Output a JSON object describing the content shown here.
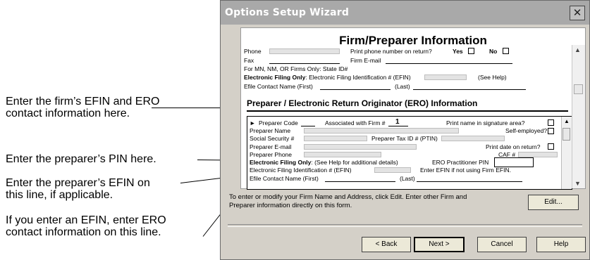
{
  "callouts": [
    {
      "line1": "Enter the firm’s EFIN and ERO",
      "line2": "contact information here."
    },
    {
      "line1": "Enter the preparer’s PIN here.",
      "line2": ""
    },
    {
      "line1": "Enter the preparer’s EFIN on",
      "line2": "this line, if applicable."
    },
    {
      "line1": "If you enter an EFIN, enter ERO",
      "line2": "contact information on this line."
    }
  ],
  "window": {
    "title": "Options Setup Wizard",
    "close_glyph": "✕",
    "heading": "Firm/Preparer Information"
  },
  "firm": {
    "phone": "Phone",
    "print_phone": "Print phone number on return?",
    "yes": "Yes",
    "no": "No",
    "fax": "Fax",
    "firm_email": "Firm E-mail",
    "state_id": "For MN, NM, OR Firms Only: State ID#",
    "efs_bold": "Electronic Filing Only",
    "efs_rest": ": Electronic Filing Identification # (EFIN)",
    "see_help": "(See Help)",
    "contact_first": "Efile Contact Name (First)",
    "contact_last": "(Last)"
  },
  "ero": {
    "section_title": "Preparer / Electronic Return Originator (ERO) Information",
    "preparer_code": "Preparer Code",
    "associated": "Associated with Firm #",
    "firm_number": "1",
    "print_name": "Print name in signature area?",
    "preparer_name": "Preparer Name",
    "self_employed": "Self-employed?",
    "ssn": "Social Security #",
    "ptin": "Preparer Tax ID # (PTIN)",
    "preparer_email": "Preparer E-mail",
    "print_date": "Print date on return?",
    "preparer_phone": "Preparer Phone",
    "caf": "CAF #",
    "efs_bold": "Electronic Filing Only",
    "efs_rest": ":  (See Help for additional details)",
    "ero_pin": "ERO Practitioner PIN",
    "efin_line": "Electronic Filing Identification # (EFIN)",
    "efin_note": "Enter EFIN if not using Firm EFIN.",
    "contact_first": "Efile Contact Name (First)",
    "contact_last": "(Last)"
  },
  "info": {
    "message": "To enter or modify your Firm Name and Address, click Edit. Enter other Firm and Preparer information directly on this form.",
    "edit_label": "Edit..."
  },
  "buttons": {
    "back": "< Back",
    "next": "Next >",
    "cancel": "Cancel",
    "help": "Help"
  }
}
